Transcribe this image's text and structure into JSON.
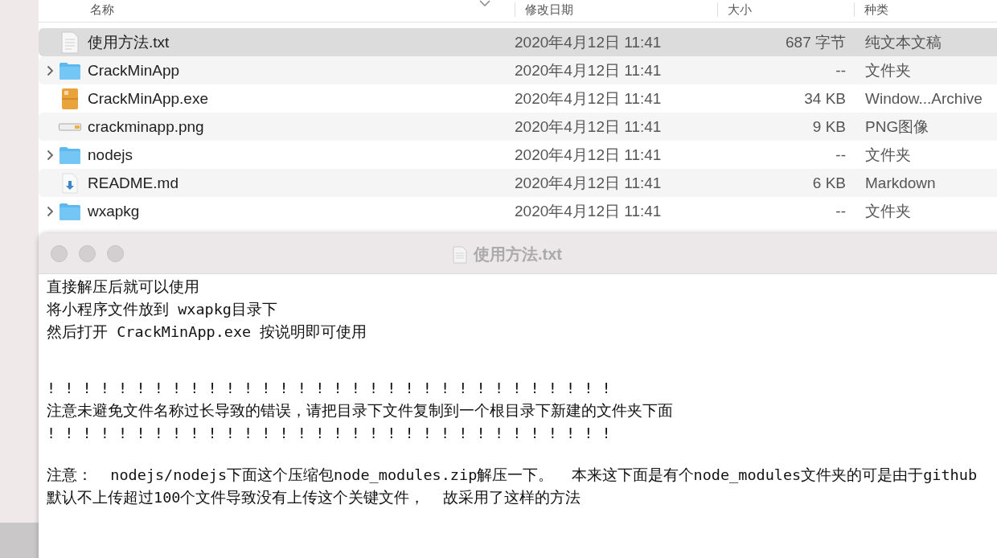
{
  "finder": {
    "columns": [
      "名称",
      "修改日期",
      "大小",
      "种类"
    ],
    "rows": [
      {
        "kind": "text",
        "name": "使用方法.txt",
        "date": "2020年4月12日 11:41",
        "size": "687 字节",
        "type": "纯文本文稿",
        "selected": true
      },
      {
        "kind": "folder",
        "name": "CrackMinApp",
        "date": "2020年4月12日 11:41",
        "size": "--",
        "type": "文件夹",
        "selected": false
      },
      {
        "kind": "exe",
        "name": "CrackMinApp.exe",
        "date": "2020年4月12日 11:41",
        "size": "34 KB",
        "type": "Window...Archive",
        "selected": false
      },
      {
        "kind": "image",
        "name": "crackminapp.png",
        "date": "2020年4月12日 11:41",
        "size": "9 KB",
        "type": "PNG图像",
        "selected": false
      },
      {
        "kind": "folder",
        "name": "nodejs",
        "date": "2020年4月12日 11:41",
        "size": "--",
        "type": "文件夹",
        "selected": false
      },
      {
        "kind": "markdown",
        "name": "README.md",
        "date": "2020年4月12日 11:41",
        "size": "6 KB",
        "type": "Markdown",
        "selected": false
      },
      {
        "kind": "folder",
        "name": "wxapkg",
        "date": "2020年4月12日 11:41",
        "size": "--",
        "type": "文件夹",
        "selected": false
      }
    ]
  },
  "editor": {
    "title": "使用方法.txt",
    "paragraphs": [
      [
        "直接解压后就可以使用",
        "将小程序文件放到 wxapkg目录下",
        "然后打开 CrackMinApp.exe 按说明即可使用"
      ],
      [
        "! ! ! ! ! ! ! ! ! ! ! ! ! ! ! ! ! ! ! ! ! ! ! ! ! ! ! ! ! ! ! !",
        "注意未避免文件名称过长导致的错误，请把目录下文件复制到一个根目录下新建的文件夹下面",
        "! ! ! ! ! ! ! ! ! ! ! ! ! ! ! ! ! ! ! ! ! ! ! ! ! ! ! ! ! ! ! !"
      ],
      [
        "注意：  nodejs/nodejs下面这个压缩包node_modules.zip解压一下。  本来这下面是有个node_modules文件夹的可是由于github",
        "默认不上传超过100个文件导致没有上传这个关键文件，  故采用了这样的方法"
      ]
    ]
  }
}
